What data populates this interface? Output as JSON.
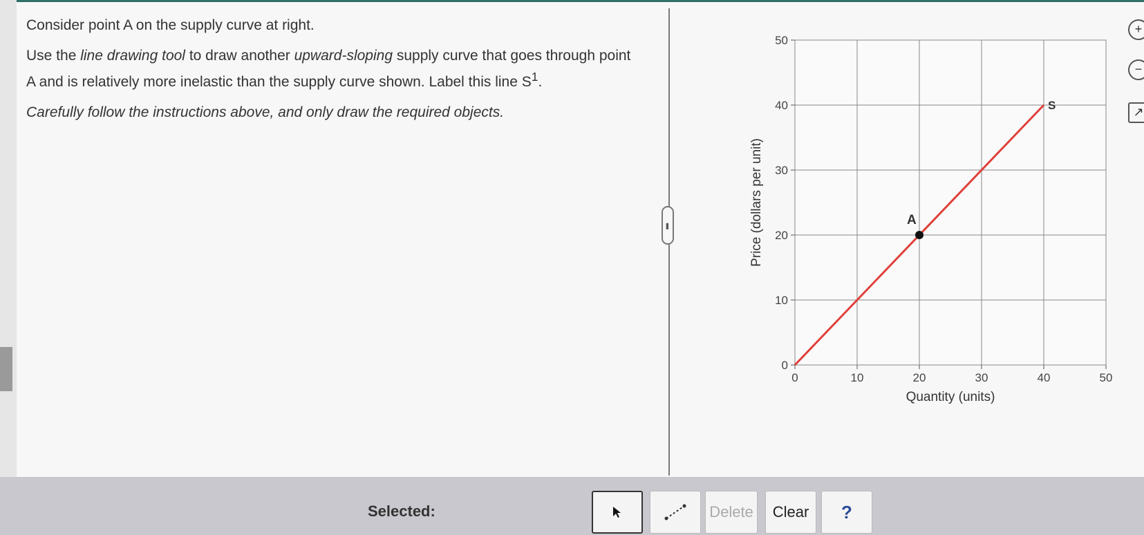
{
  "question": {
    "line1": "Consider point A on the supply curve at right.",
    "line2": {
      "p1": "Use the ",
      "tool": "line drawing tool",
      "p2": " to draw another ",
      "slope": "upward-sloping",
      "p3": " supply curve that goes through point A and is relatively more inelastic than the supply curve shown. Label this line S",
      "sup": "1",
      "end": "."
    },
    "line3": "Carefully follow the instructions above, and only draw the required objects."
  },
  "chart_data": {
    "type": "line",
    "xlabel": "Quantity (units)",
    "ylabel": "Price (dollars per unit)",
    "xlim": [
      0,
      50
    ],
    "ylim": [
      0,
      50
    ],
    "x_ticks": [
      0,
      10,
      20,
      30,
      40,
      50
    ],
    "y_ticks": [
      0,
      10,
      20,
      30,
      40,
      50
    ],
    "grid": true,
    "series": [
      {
        "name": "S",
        "color": "#e0403a",
        "points": [
          [
            0,
            0
          ],
          [
            40,
            40
          ]
        ]
      }
    ],
    "points": [
      {
        "label": "A",
        "x": 20,
        "y": 20,
        "color": "#111111"
      }
    ]
  },
  "side_icons": [
    "zoom-in-icon",
    "zoom-out-icon",
    "popout-icon"
  ],
  "toolbar": {
    "selected_label": "Selected:",
    "delete_label": "Delete",
    "clear_label": "Clear",
    "help_label": "?"
  }
}
